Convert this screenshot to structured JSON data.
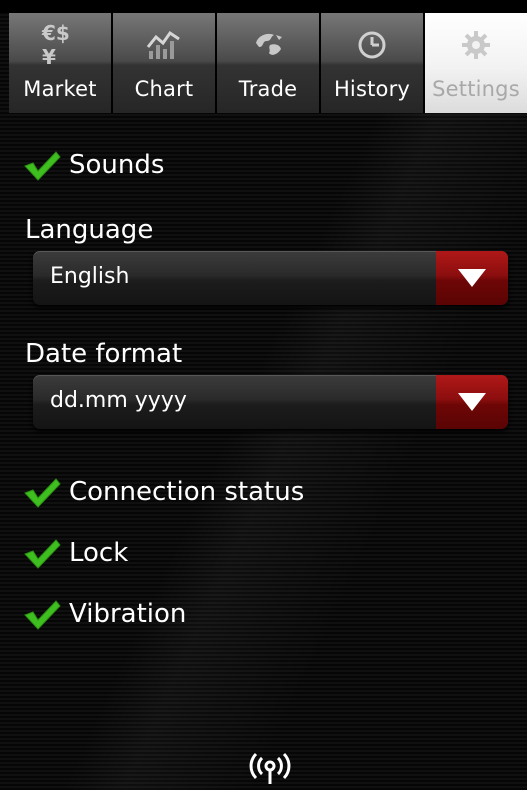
{
  "tabs": [
    {
      "label": "Market",
      "icon": "currency-icon",
      "glyph": "€$¥"
    },
    {
      "label": "Chart",
      "icon": "chart-icon"
    },
    {
      "label": "Trade",
      "icon": "globe-icon"
    },
    {
      "label": "History",
      "icon": "clock-icon"
    },
    {
      "label": "Settings",
      "icon": "gear-icon",
      "active": true
    }
  ],
  "settings": {
    "sounds_label": "Sounds",
    "sounds_checked": true,
    "language_label": "Language",
    "language_value": "English",
    "date_format_label": "Date format",
    "date_format_value": "dd.mm yyyy",
    "connection_status_label": "Connection status",
    "connection_status_checked": true,
    "lock_label": "Lock",
    "lock_checked": true,
    "vibration_label": "Vibration",
    "vibration_checked": true
  },
  "colors": {
    "check_green": "#3fbf1f",
    "dropdown_arrow_bg": "#8c0e0e",
    "active_tab_bg": "#f2f2f2"
  },
  "footer": {
    "icon": "signal-icon"
  }
}
